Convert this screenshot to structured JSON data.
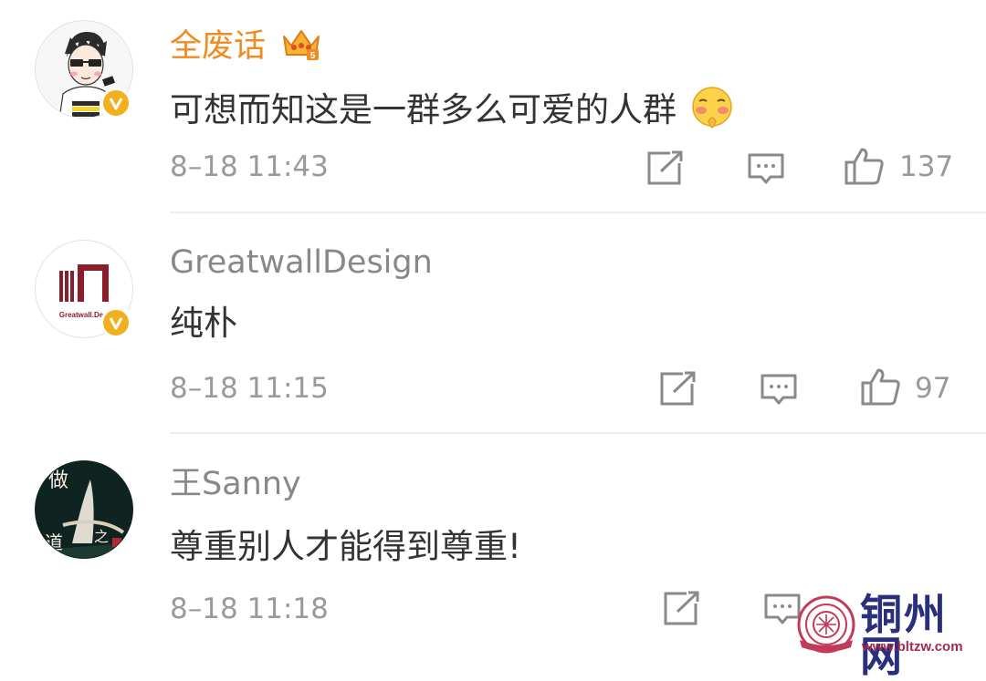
{
  "comments": [
    {
      "username": "全废话",
      "text": "可想而知这是一群多么可爱的人群",
      "time": "8–18 11:43",
      "likes": "137",
      "vip_badge_level": "5",
      "emoji": "shy-face-emoji"
    },
    {
      "username": "GreatwallDesign",
      "text": "纯朴",
      "time": "8–18 11:15",
      "likes": "97",
      "avatar_logo_text": "Greatwall.De"
    },
    {
      "username": "王Sanny",
      "text": "尊重别人才能得到尊重!",
      "time": "8–18 11:18",
      "likes": "",
      "avatar_art_text": [
        "做",
        "道",
        "之"
      ]
    }
  ],
  "watermark": {
    "name": "铜州网",
    "url": "www.bltzw.com"
  },
  "colors": {
    "vip_name": "#f08b1f",
    "username": "#888888",
    "text": "#333333",
    "meta": "#9a9a9a",
    "verified_badge": "#f2b01e"
  },
  "icons": [
    "repost-icon",
    "comment-icon",
    "like-icon",
    "verified-badge-icon",
    "vip-crown-icon"
  ]
}
